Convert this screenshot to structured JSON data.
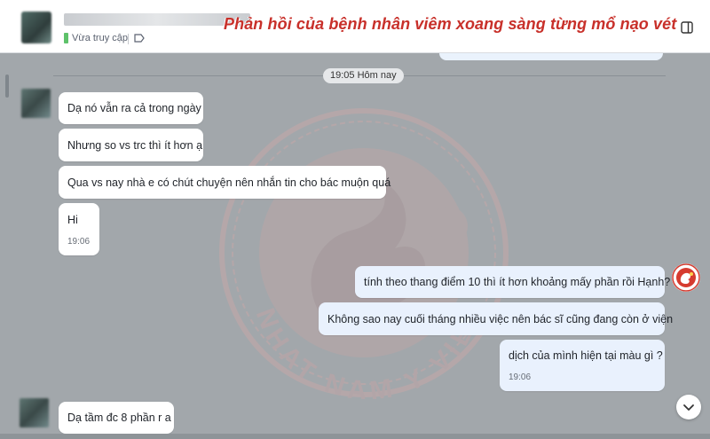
{
  "header": {
    "status_text": "Vừa truy cập",
    "banner_title": "Phản hồi của bệnh nhân viêm xoang sàng từng mổ nạo vét",
    "icons": [
      "tag-icon",
      "sidebar-panel-icon"
    ]
  },
  "chat": {
    "time_divider": "19:05 Hôm nay",
    "watermark_text": "NHAT NAM Y VIEN",
    "messages": [
      {
        "sender": "patient",
        "text": "Dạ nó vẫn ra cả trong ngày"
      },
      {
        "sender": "patient",
        "text": "Nhưng so vs trc thì ít hơn ạ"
      },
      {
        "sender": "patient",
        "text": "Qua vs nay nhà e có chút chuyện nên nhắn tin cho bác muộn quá"
      },
      {
        "sender": "patient",
        "text": "Hi",
        "time": "19:06"
      },
      {
        "sender": "staff",
        "text": "tính theo thang điểm 10 thì ít hơn khoảng mấy phần rồi Hạnh?"
      },
      {
        "sender": "staff",
        "text": "Không sao nay cuối tháng nhiều việc nên bác sĩ cũng đang còn ở viện"
      },
      {
        "sender": "staff",
        "text": "dịch của mình hiện tại màu gì ?",
        "time": "19:06"
      },
      {
        "sender": "patient",
        "text": "Dạ tầm đc 8 phần r a"
      }
    ]
  },
  "colors": {
    "banner": "#c8302a",
    "chat_bg": "#a2a7ab",
    "my_bubble": "#e9f1fd",
    "their_bubble": "#ffffff",
    "online": "#5ec26a"
  }
}
